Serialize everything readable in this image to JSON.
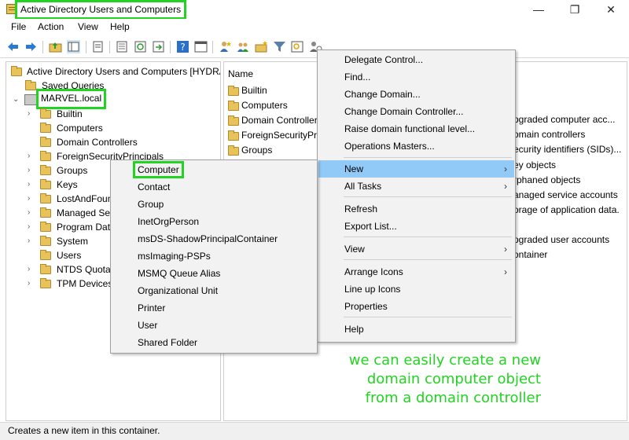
{
  "window": {
    "title": "Active Directory Users and Computers",
    "controls": {
      "minimize": "—",
      "maximize": "❐",
      "close": "✕"
    }
  },
  "menubar": [
    "File",
    "Action",
    "View",
    "Help"
  ],
  "toolbar": {
    "icons": [
      "back-arrow-icon",
      "forward-arrow-icon",
      "up-folder-icon",
      "show-console-tree-icon",
      "properties-icon",
      "export-list-icon",
      "refresh-icon",
      "help-icon",
      "console-view-icon",
      "add-user-icon",
      "add-group-icon",
      "add-ou-icon",
      "filter-icon",
      "find-icon",
      "delegate-icon"
    ]
  },
  "tree": {
    "root": "Active Directory Users and Computers [HYDRA",
    "saved_queries": "Saved Queries",
    "domain": "MARVEL.local",
    "children": [
      "Builtin",
      "Computers",
      "Domain Controllers",
      "ForeignSecurityPrincipals",
      "Groups",
      "Keys",
      "LostAndFoun",
      "Managed Ser",
      "Program Dat",
      "System",
      "Users",
      "NTDS Quotas",
      "TPM Devices"
    ]
  },
  "list": {
    "column_name": "Name",
    "rows": [
      {
        "name": "Builtin",
        "desc": ""
      },
      {
        "name": "Computers",
        "desc": "pgraded computer acc..."
      },
      {
        "name": "Domain Controller",
        "desc": "omain controllers"
      },
      {
        "name": "ForeignSecurityPri",
        "desc": "ecurity identifiers (SIDs)..."
      },
      {
        "name": "Groups",
        "desc": ""
      }
    ],
    "more_desc": [
      "ey objects",
      "rphaned objects",
      "anaged service accounts",
      "orage of application data.",
      "",
      "pgraded user accounts",
      "ontainer"
    ]
  },
  "context_menu": {
    "items": [
      "Delegate Control...",
      "Find...",
      "Change Domain...",
      "Change Domain Controller...",
      "Raise domain functional level...",
      "Operations Masters...",
      "New",
      "All Tasks",
      "Refresh",
      "Export List...",
      "View",
      "Arrange Icons",
      "Line up Icons",
      "Properties",
      "Help"
    ],
    "submenu_arrow": "›"
  },
  "new_submenu": {
    "items": [
      "Computer",
      "Contact",
      "Group",
      "InetOrgPerson",
      "msDS-ShadowPrincipalContainer",
      "msImaging-PSPs",
      "MSMQ Queue Alias",
      "Organizational Unit",
      "Printer",
      "User",
      "Shared Folder"
    ]
  },
  "status": "Creates a new item in this container.",
  "annotation": [
    "we can easily create a new",
    "domain computer object",
    "from a domain controller"
  ],
  "colors": {
    "highlight": "#22d322",
    "menu_active": "#91c9f7"
  }
}
